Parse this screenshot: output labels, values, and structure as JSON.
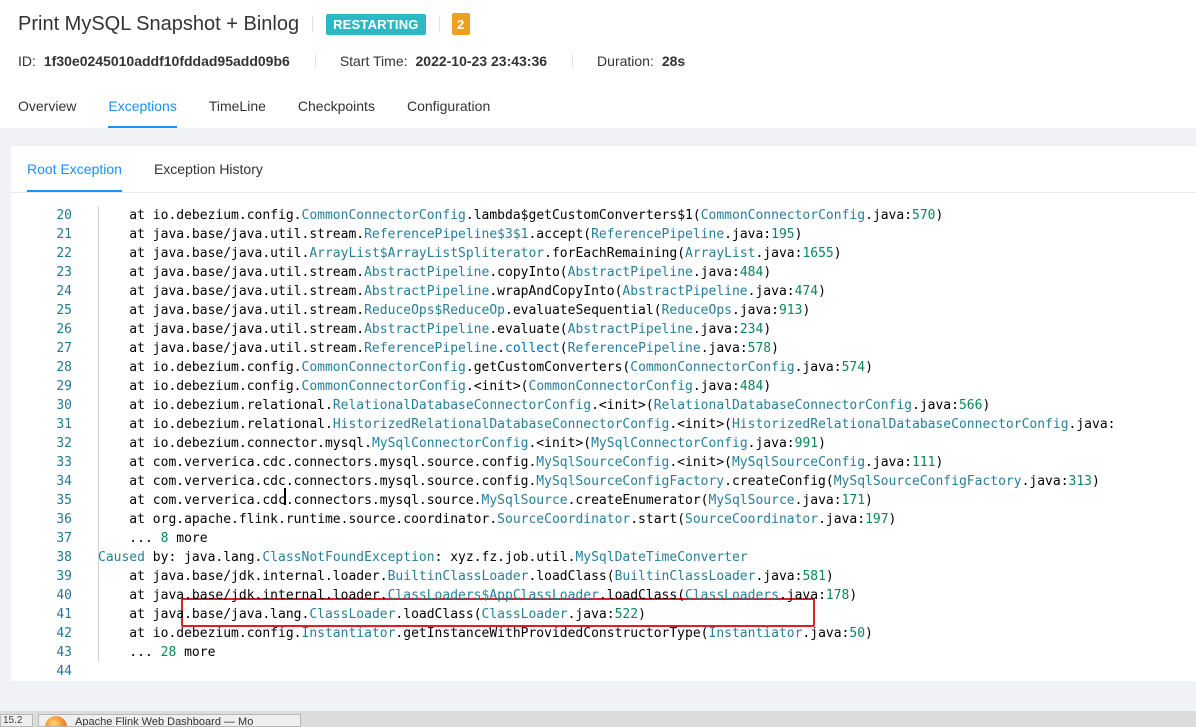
{
  "header": {
    "title": "Print MySQL Snapshot + Binlog",
    "status": "RESTARTING",
    "count": "2",
    "id_label": "ID:",
    "id_value": "1f30e0245010addf10fddad95add09b6",
    "start_label": "Start Time:",
    "start_value": "2022-10-23 23:43:36",
    "duration_label": "Duration:",
    "duration_value": "28s"
  },
  "tabs": [
    "Overview",
    "Exceptions",
    "TimeLine",
    "Checkpoints",
    "Configuration"
  ],
  "active_tab": "Exceptions",
  "subtabs": [
    "Root Exception",
    "Exception History"
  ],
  "active_subtab": "Root Exception",
  "colors": {
    "status_badge": "#2cb8c4",
    "count_badge": "#f0a020",
    "accent": "#1890ff",
    "highlight_box": "#e02020"
  },
  "code_lines": [
    {
      "n": "20",
      "t": "    at io.debezium.config.CommonConnectorConfig.lambda$getCustomConverters$1(CommonConnectorConfig.java:570)"
    },
    {
      "n": "21",
      "t": "    at java.base/java.util.stream.ReferencePipeline$3$1.accept(ReferencePipeline.java:195)"
    },
    {
      "n": "22",
      "t": "    at java.base/java.util.ArrayList$ArrayListSpliterator.forEachRemaining(ArrayList.java:1655)"
    },
    {
      "n": "23",
      "t": "    at java.base/java.util.stream.AbstractPipeline.copyInto(AbstractPipeline.java:484)"
    },
    {
      "n": "24",
      "t": "    at java.base/java.util.stream.AbstractPipeline.wrapAndCopyInto(AbstractPipeline.java:474)"
    },
    {
      "n": "25",
      "t": "    at java.base/java.util.stream.ReduceOps$ReduceOp.evaluateSequential(ReduceOps.java:913)"
    },
    {
      "n": "26",
      "t": "    at java.base/java.util.stream.AbstractPipeline.evaluate(AbstractPipeline.java:234)"
    },
    {
      "n": "27",
      "t": "    at java.base/java.util.stream.ReferencePipeline.collect(ReferencePipeline.java:578)"
    },
    {
      "n": "28",
      "t": "    at io.debezium.config.CommonConnectorConfig.getCustomConverters(CommonConnectorConfig.java:574)"
    },
    {
      "n": "29",
      "t": "    at io.debezium.config.CommonConnectorConfig.<init>(CommonConnectorConfig.java:484)"
    },
    {
      "n": "30",
      "t": "    at io.debezium.relational.RelationalDatabaseConnectorConfig.<init>(RelationalDatabaseConnectorConfig.java:566)"
    },
    {
      "n": "31",
      "t": "    at io.debezium.relational.HistorizedRelationalDatabaseConnectorConfig.<init>(HistorizedRelationalDatabaseConnectorConfig.java:"
    },
    {
      "n": "32",
      "t": "    at io.debezium.connector.mysql.MySqlConnectorConfig.<init>(MySqlConnectorConfig.java:991)"
    },
    {
      "n": "33",
      "t": "    at com.ververica.cdc.connectors.mysql.source.config.MySqlSourceConfig.<init>(MySqlSourceConfig.java:111)"
    },
    {
      "n": "34",
      "t": "    at com.ververica.cdc.connectors.mysql.source.config.MySqlSourceConfigFactory.createConfig(MySqlSourceConfigFactory.java:313)"
    },
    {
      "n": "35",
      "t": "    at com.ververica.cdc.connectors.mysql.source.MySqlSource.createEnumerator(MySqlSource.java:171)"
    },
    {
      "n": "36",
      "t": "    at org.apache.flink.runtime.source.coordinator.SourceCoordinator.start(SourceCoordinator.java:197)"
    },
    {
      "n": "37",
      "t": "    ... 8 more"
    },
    {
      "n": "38",
      "t": "Caused by: java.lang.ClassNotFoundException: xyz.fz.job.util.MySqlDateTimeConverter"
    },
    {
      "n": "39",
      "t": "    at java.base/jdk.internal.loader.BuiltinClassLoader.loadClass(BuiltinClassLoader.java:581)"
    },
    {
      "n": "40",
      "t": "    at java.base/jdk.internal.loader.ClassLoaders$AppClassLoader.loadClass(ClassLoaders.java:178)"
    },
    {
      "n": "41",
      "t": "    at java.base/java.lang.ClassLoader.loadClass(ClassLoader.java:522)"
    },
    {
      "n": "42",
      "t": "    at io.debezium.config.Instantiator.getInstanceWithProvidedConstructorType(Instantiator.java:50)"
    },
    {
      "n": "43",
      "t": "    ... 28 more"
    },
    {
      "n": "44",
      "t": ""
    }
  ],
  "taskbar": {
    "item1": "15.2",
    "item2": "Apache Flink Web Dashboard — Mo"
  }
}
